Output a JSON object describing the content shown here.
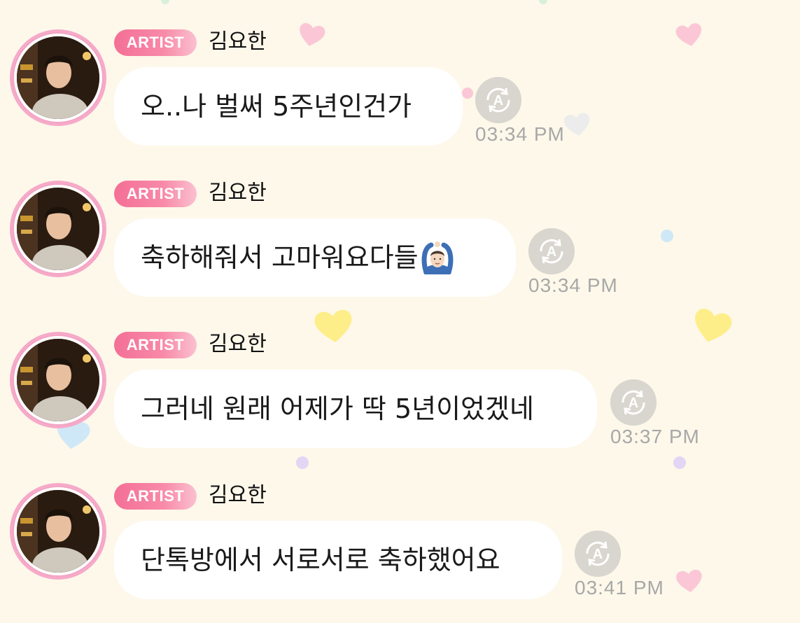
{
  "colors": {
    "background": "#fdf8ea",
    "badge_pink": "#f46f96",
    "bubble": "#ffffff",
    "timestamp": "#a8a8a8",
    "translate_button": "#d9d6cf"
  },
  "messages": [
    {
      "badge": "ARTIST",
      "sender": "김요한",
      "text": "오..나 벌써 5주년인건가",
      "time": "03:34 PM",
      "translate_icon": "translate-a-icon"
    },
    {
      "badge": "ARTIST",
      "sender": "김요한",
      "text": "축하해줘서 고마워요다들",
      "emoji": "person-gesturing-ok-emoji",
      "time": "03:34 PM",
      "translate_icon": "translate-a-icon"
    },
    {
      "badge": "ARTIST",
      "sender": "김요한",
      "text": "그러네 원래 어제가 딱 5년이었겠네",
      "time": "03:37 PM",
      "translate_icon": "translate-a-icon"
    },
    {
      "badge": "ARTIST",
      "sender": "김요한",
      "text": "단톡방에서 서로서로 축하했어요",
      "time": "03:41 PM",
      "translate_icon": "translate-a-icon"
    }
  ]
}
